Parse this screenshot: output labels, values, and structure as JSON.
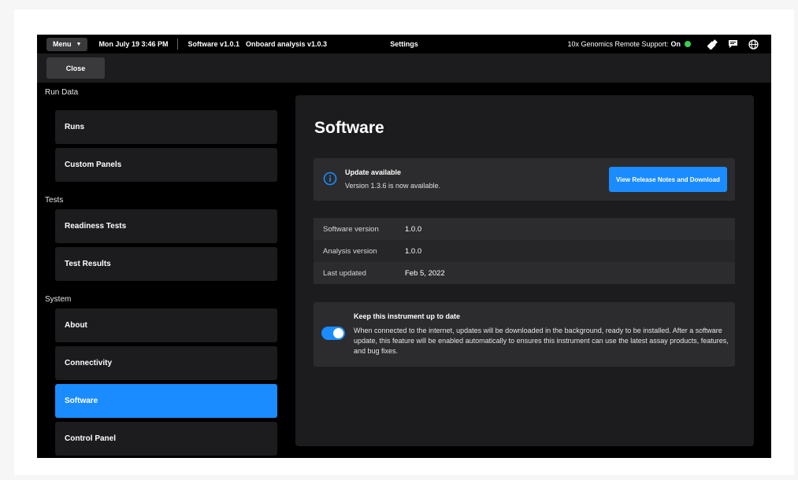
{
  "topbar": {
    "menu_label": "Menu",
    "datetime": "Mon July 19  3:46 PM",
    "software": "Software v1.0.1",
    "analysis": "Onboard analysis v1.0.3",
    "title": "Settings",
    "support_label": "10x Genomics Remote Support:",
    "support_status": "On",
    "icons": [
      "usb-drive-icon",
      "message-icon",
      "globe-icon"
    ]
  },
  "subbar": {
    "close_label": "Close"
  },
  "sidebar": {
    "sections": [
      {
        "label": "Run Data",
        "items": [
          "Runs",
          "Custom Panels"
        ]
      },
      {
        "label": "Tests",
        "items": [
          "Readiness Tests",
          "Test Results"
        ]
      },
      {
        "label": "System",
        "items": [
          "About",
          "Connectivity",
          "Software",
          "Control Panel"
        ]
      }
    ],
    "active_item": "Software"
  },
  "main": {
    "title": "Software",
    "update": {
      "title": "Update available",
      "subtitle": "Version 1.3.6 is now available.",
      "button": "View Release Notes and Download"
    },
    "info": [
      {
        "key": "Software version",
        "value": "1.0.0"
      },
      {
        "key": "Analysis version",
        "value": "1.0.0"
      },
      {
        "key": "Last updated",
        "value": "Feb 5, 2022"
      }
    ],
    "keep": {
      "title": "Keep this instrument up to date",
      "description": "When connected to the internet, updates will be downloaded in the background, ready to be installed. After a software update, this feature will be enabled automatically to ensures this instrument can use the latest assay products, features, and bug fixes.",
      "enabled": true
    }
  },
  "colors": {
    "accent": "#1a8cff",
    "status_on": "#3ccf4e",
    "card": "#2c2c2e",
    "panel": "#1c1c1e",
    "background": "#000000"
  }
}
